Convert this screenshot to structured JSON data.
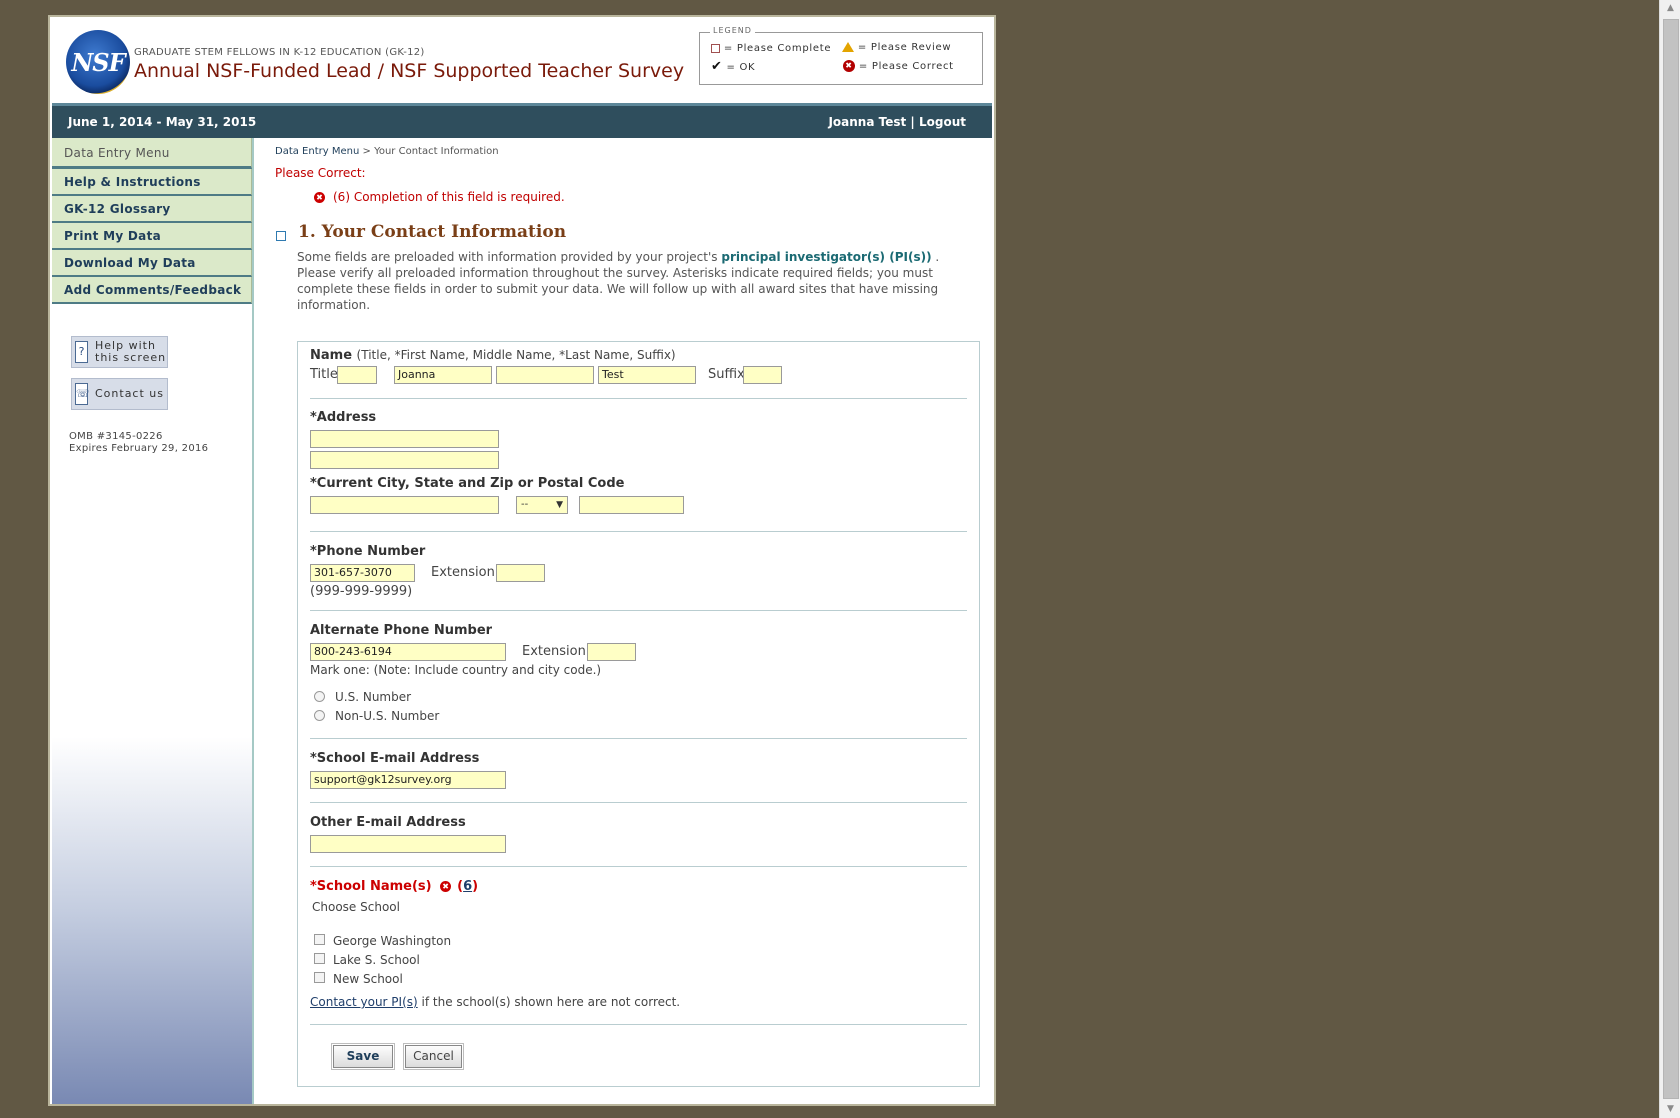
{
  "header": {
    "subtitle": "GRADUATE STEM FELLOWS IN K-12 EDUCATION (GK-12)",
    "title": "Annual NSF-Funded Lead / NSF Supported Teacher Survey",
    "logo_text": "NSF",
    "legend": {
      "title": "LEGEND",
      "please_complete": "= Please Complete",
      "please_review": "= Please Review",
      "ok": "= OK",
      "please_correct": "= Please Correct"
    }
  },
  "bar": {
    "dates": "June 1, 2014 - May 31, 2015",
    "user": "Joanna Test",
    "separator": "|",
    "logout": "Logout"
  },
  "sidebar": {
    "items": [
      {
        "label": "Data Entry Menu"
      },
      {
        "label": "Help & Instructions"
      },
      {
        "label": "GK-12 Glossary"
      },
      {
        "label": "Print My Data"
      },
      {
        "label": "Download My Data"
      },
      {
        "label": "Add Comments/Feedback"
      }
    ],
    "help_screen_line1": "Help with",
    "help_screen_line2": "this screen",
    "contact_us": "Contact us",
    "omb_line1": "OMB #3145-0226",
    "omb_line2": "Expires February 29, 2016"
  },
  "main": {
    "breadcrumb_link": "Data Entry Menu",
    "breadcrumb_sep": ">",
    "breadcrumb_current": "Your Contact Information",
    "please_correct": "Please Correct:",
    "error_text": "(6) Completion of this field is required.",
    "section_title": "1. Your Contact Information",
    "intro_before": "Some fields are preloaded with information provided by your project's",
    "intro_link": "principal investigator(s) (PI(s))",
    "intro_after": ". Please verify all preloaded information throughout the survey. Asterisks indicate required fields; you must complete these fields in order to submit your data. We will follow up with all award sites that have missing information."
  },
  "form": {
    "name_label": "Name",
    "name_hint": "(Title, *First Name, Middle Name, *Last Name, Suffix)",
    "title_label": "Title",
    "title_value": "",
    "first_name": "Joanna",
    "middle_name": "",
    "last_name": "Test",
    "suffix_label": "Suffix",
    "suffix_value": "",
    "address_label": "*Address",
    "address1": "",
    "address2": "",
    "city_label": "*Current City, State and Zip or Postal Code",
    "city": "",
    "state": "--",
    "zip": "",
    "phone_label": "*Phone Number",
    "phone": "301-657-3070",
    "extension_label": "Extension",
    "phone_ext": "",
    "phone_format": "(999-999-9999)",
    "alt_phone_label": "Alternate Phone Number",
    "alt_phone": "800-243-6194",
    "alt_ext": "",
    "mark_one": "Mark one: (Note: Include country and city code.)",
    "us_number": "U.S. Number",
    "non_us_number": "Non-U.S. Number",
    "school_email_label": "*School E-mail Address",
    "school_email": "support@gk12survey.org",
    "other_email_label": "Other E-mail Address",
    "other_email": "",
    "school_names_label": "*School Name(s)",
    "school_error_num": "6",
    "choose_school": "Choose School",
    "schools": [
      "George Washington",
      "Lake S. School",
      "New School"
    ],
    "contact_pi_link": "Contact your PI(s)",
    "contact_pi_after": "if the school(s) shown here are not correct.",
    "save": "Save",
    "cancel": "Cancel"
  },
  "colors": {
    "background": "#615844",
    "nav_bar": "#2f4e5d",
    "menu_bg": "#dbe9c9",
    "title": "#7a1a0a",
    "error": "#c00000",
    "input_bg": "#ffffc5"
  }
}
